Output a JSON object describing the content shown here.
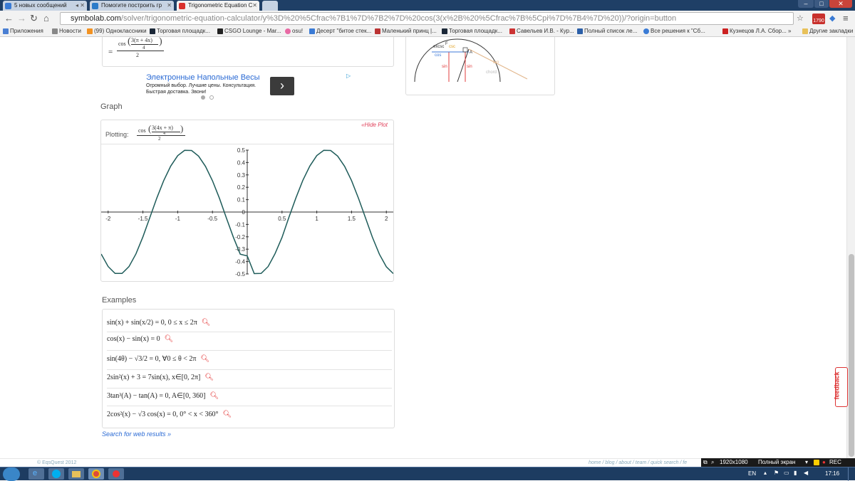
{
  "browser": {
    "tabs": [
      {
        "label": "5 новых сообщений",
        "active": false
      },
      {
        "label": "Помогите построить гр",
        "active": false
      },
      {
        "label": "Trigonometric Equation C",
        "active": true
      }
    ],
    "url_host": "symbolab.com",
    "url_path": "/solver/trigonometric-equation-calculator/y%3D%20%5Cfrac%7B1%7D%7B2%7D%20cos(3(x%2B%20%5Cfrac%7B%5Cpi%7D%7B4%7D%20))/?origin=button",
    "badge": "1790",
    "bookmarks": [
      "Приложения",
      "Новости",
      "(99) Одноклассники",
      "Торговая площадк...",
      "CSGO Lounge - Mar...",
      "osu!",
      "Десерт \"битое стек...",
      "Маленький принц |...",
      "Торговая площадк...",
      "Савельев И.В. - Кур...",
      "Полный список ле...",
      "Все решения к \"Сб...",
      "Кузнецов Л.А. Сбор...",
      "»",
      "Другие закладки"
    ]
  },
  "solution": {
    "eq_sign": "=",
    "cos": "cos",
    "inner_num": "3(π + 4x)",
    "inner_den": "4",
    "outer_den": "2"
  },
  "ad": {
    "title": "Электронные Напольные Весы",
    "line1": "Огромный выбор. Лучшие цены. Консультация.",
    "line2": "Быстрая доставка. Звони!",
    "arrow": "›",
    "corner": "▷"
  },
  "diagram": {
    "labels": [
      "F",
      "excsc",
      "csc",
      "A",
      "sin",
      "sin",
      "chord",
      "tan",
      "cos"
    ]
  },
  "graph": {
    "section_title": "Graph",
    "hide_plot": "«Hide Plot",
    "plotting_label": "Plotting:",
    "formula_cos": "cos",
    "formula_num": "3(4x + π)",
    "formula_inner_den": "4",
    "formula_den": "2"
  },
  "chart_data": {
    "type": "line",
    "title": "",
    "xlabel": "",
    "ylabel": "",
    "xlim": [
      -2.1,
      2.1
    ],
    "ylim": [
      -0.5,
      0.5
    ],
    "x_ticks": [
      -2,
      -1.5,
      -1,
      -0.5,
      0.5,
      1,
      1.5,
      2
    ],
    "y_ticks": [
      0.5,
      0.4,
      0.3,
      0.2,
      0.1,
      0,
      -0.1,
      -0.2,
      -0.3,
      -0.4,
      -0.5
    ],
    "series": [
      {
        "color": "#1f5c5a",
        "x": [
          -2.1,
          -2.0,
          -1.9,
          -1.8,
          -1.7,
          -1.6,
          -1.5,
          -1.4,
          -1.3,
          -1.2,
          -1.1,
          -1.0,
          -0.9,
          -0.8,
          -0.7,
          -0.6,
          -0.5,
          -0.4,
          -0.3,
          -0.2,
          -0.1,
          0.0,
          0.1,
          0.2,
          0.3,
          0.4,
          0.5,
          0.6,
          0.7,
          0.8,
          0.9,
          1.0,
          1.1,
          1.2,
          1.3,
          1.4,
          1.5,
          1.6,
          1.7,
          1.8,
          1.9,
          2.0,
          2.1
        ],
        "y": [
          -0.339,
          -0.44,
          -0.496,
          -0.496,
          -0.441,
          -0.338,
          -0.2,
          -0.044,
          0.113,
          0.256,
          0.371,
          0.455,
          0.498,
          0.497,
          0.452,
          0.369,
          0.253,
          0.111,
          -0.047,
          -0.203,
          -0.34,
          -0.354,
          -0.497,
          -0.496,
          -0.44,
          -0.337,
          -0.205,
          -0.041,
          0.114,
          0.257,
          0.372,
          0.456,
          0.498,
          0.497,
          0.452,
          0.369,
          0.254,
          0.11,
          -0.047,
          -0.204,
          -0.341,
          -0.442,
          -0.497
        ]
      }
    ]
  },
  "examples": {
    "section_title": "Examples",
    "items": [
      "sin(x) + sin(x/2) = 0, 0 ≤ x ≤ 2π",
      "cos(x) − sin(x) = 0",
      "sin(4θ) − √3/2 = 0, ∀0 ≤ θ < 2π",
      "2sin²(x) + 3 = 7sin(x), x∈[0, 2π]",
      "3tan³(A) − tan(A) = 0, A∈[0, 360]",
      "2cos²(x) − √3 cos(x) = 0, 0° < x < 360°"
    ],
    "search_link": "Search for web results »"
  },
  "footer": {
    "copyright": "© EqsQuest 2012",
    "links": "home / blog / about / team / quick search / fe"
  },
  "feedback": "feedback",
  "fullscreen_bar": {
    "resolution": "1920x1080",
    "mode": "Полный экран",
    "rec": "REC"
  },
  "taskbar": {
    "lang": "EN",
    "clock": "17:16"
  }
}
